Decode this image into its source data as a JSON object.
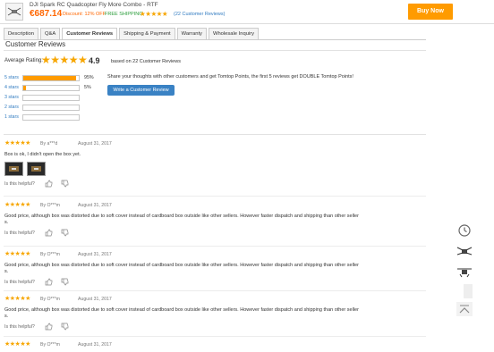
{
  "product": {
    "title": "DJI Spark RC Quadcopter Fly More Combo - RTF",
    "price": "€687.14",
    "discount": "Discount: 12% OFF",
    "shipping": "FREE SHIPPING",
    "rating_stars": "★★★★★",
    "reviews_link": "(22 Customer Reviews)",
    "buy_label": "Buy Now"
  },
  "tabs": [
    {
      "label": "Description",
      "active": false
    },
    {
      "label": "Q&A",
      "active": false
    },
    {
      "label": "Customer Reviews",
      "active": true
    },
    {
      "label": "Shipping & Payment",
      "active": false
    },
    {
      "label": "Warranty",
      "active": false
    },
    {
      "label": "Wholesale Inquiry",
      "active": false
    }
  ],
  "reviews_section": {
    "title": "Customer Reviews",
    "average_label": "Average Rating:",
    "average_stars": "★★★★★",
    "average_value": "4.9",
    "based_on": "based on 22 Customer Reviews",
    "share_text": "Share your thoughts with other customers and get Tomtop Points, the first 5 reviews get DOUBLE Tomtop Points!",
    "write_button": "Write a Customer Review",
    "breakdown": [
      {
        "label": "5 stars",
        "percent": 95,
        "percent_label": "95%"
      },
      {
        "label": "4 stars",
        "percent": 5,
        "percent_label": "5%"
      },
      {
        "label": "3 stars",
        "percent": 0,
        "percent_label": ""
      },
      {
        "label": "2 stars",
        "percent": 0,
        "percent_label": ""
      },
      {
        "label": "1 stars",
        "percent": 0,
        "percent_label": ""
      }
    ]
  },
  "helpful_label": "Is this helpful?",
  "reviews": [
    {
      "stars": "★★★★★",
      "author": "By a***d",
      "date": "August 31, 2017",
      "text": "Box is ok, I didn't open the box yet.",
      "photos": 2
    },
    {
      "stars": "★★★★★",
      "author": "By O***m",
      "date": "August 31, 2017",
      "text": "Good price, although box was distorted due to soft cover instead of cardboard box outside like other sellers. However faster dispatch and shipping than other seller s.",
      "photos": 0
    },
    {
      "stars": "★★★★★",
      "author": "By O***m",
      "date": "August 31, 2017",
      "text": "Good price, although box was distorted due to soft cover instead of cardboard box outside like other sellers. However faster dispatch and shipping than other seller s.",
      "photos": 0
    },
    {
      "stars": "★★★★★",
      "author": "By O***m",
      "date": "August 31, 2017",
      "text": "Good price, although box was distorted due to soft cover instead of cardboard box outside like other sellers. However faster dispatch and shipping than other seller s.",
      "photos": 0
    },
    {
      "stars": "★★★★★",
      "author": "By O***m",
      "date": "August 31, 2017",
      "text": "",
      "photos": 0
    }
  ],
  "side_tools": [
    {
      "icon": "history-clock-icon"
    },
    {
      "icon": "drone-icon"
    },
    {
      "icon": "drone-icon"
    },
    {
      "icon": "blank-panel-icon"
    },
    {
      "icon": "back-to-top-icon"
    }
  ]
}
